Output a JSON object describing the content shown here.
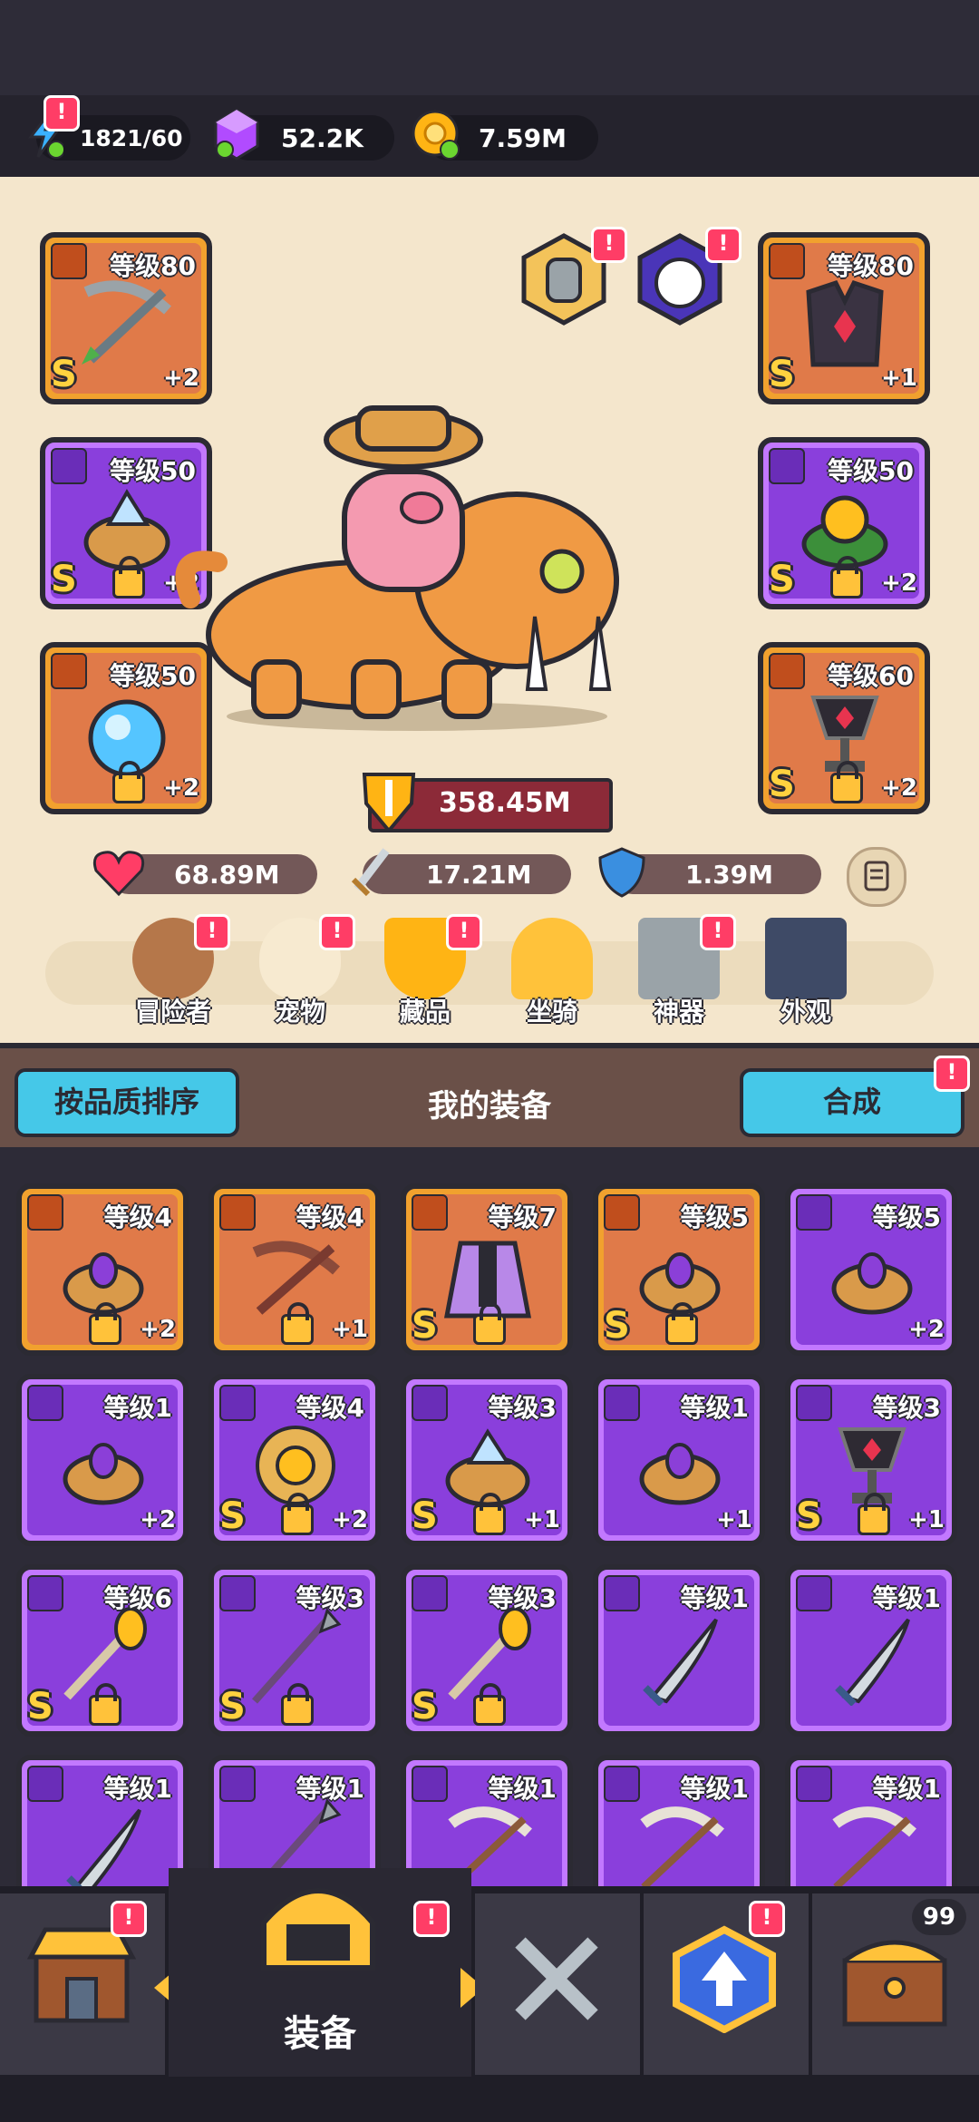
{
  "resources": {
    "energy": "1821/60",
    "gems": "52.2K",
    "gold": "7.59M"
  },
  "equipped": {
    "left": [
      {
        "level": "等级80",
        "plus": "+2",
        "grade": "S",
        "rarity": "orange",
        "item": "crossbow-icon",
        "locked": false
      },
      {
        "level": "等级50",
        "plus": "+2",
        "grade": "S",
        "rarity": "purple",
        "item": "crystal-ring-icon",
        "locked": true
      },
      {
        "level": "等级50",
        "plus": "+2",
        "grade": "",
        "rarity": "orange",
        "item": "blue-orb-necklace-icon",
        "locked": true
      }
    ],
    "right": [
      {
        "level": "等级80",
        "plus": "+1",
        "grade": "S",
        "rarity": "orange",
        "item": "dark-armor-icon",
        "locked": false
      },
      {
        "level": "等级50",
        "plus": "+2",
        "grade": "S",
        "rarity": "purple",
        "item": "gold-orb-ring-icon",
        "locked": true
      },
      {
        "level": "等级60",
        "plus": "+2",
        "grade": "S",
        "rarity": "orange",
        "item": "chalice-icon",
        "locked": true
      }
    ]
  },
  "power": "358.45M",
  "stats": {
    "hp": "68.89M",
    "attack": "17.21M",
    "defense": "1.39M"
  },
  "menu": [
    {
      "label": "冒险者",
      "icon": "capybara-icon",
      "badge": "!"
    },
    {
      "label": "宠物",
      "icon": "egg-icon",
      "badge": "!"
    },
    {
      "label": "藏品",
      "icon": "trophy-icon",
      "badge": "!"
    },
    {
      "label": "坐骑",
      "icon": "horseshoe-icon",
      "badge": ""
    },
    {
      "label": "神器",
      "icon": "hammer-icon",
      "badge": "!"
    },
    {
      "label": "外观",
      "icon": "outfit-icon",
      "badge": ""
    }
  ],
  "section": {
    "sort_label": "按品质排序",
    "title": "我的装备",
    "merge_label": "合成"
  },
  "inventory": [
    {
      "level": "等级4",
      "plus": "+2",
      "grade": "",
      "rarity": "orange",
      "item": "ring-icon"
    },
    {
      "level": "等级4",
      "plus": "+1",
      "grade": "",
      "rarity": "orange",
      "item": "crossbow-icon"
    },
    {
      "level": "等级7",
      "plus": "",
      "grade": "S",
      "rarity": "orange",
      "item": "cape-icon"
    },
    {
      "level": "等级5",
      "plus": "",
      "grade": "S",
      "rarity": "orange",
      "item": "ring-icon"
    },
    {
      "level": "等级5",
      "plus": "+2",
      "grade": "",
      "rarity": "purple",
      "item": "ring-icon"
    },
    {
      "level": "等级1",
      "plus": "+2",
      "grade": "",
      "rarity": "purple",
      "item": "ring-icon"
    },
    {
      "level": "等级4",
      "plus": "+2",
      "grade": "S",
      "rarity": "purple",
      "item": "sun-medal-icon"
    },
    {
      "level": "等级3",
      "plus": "+1",
      "grade": "S",
      "rarity": "purple",
      "item": "crystal-ring-icon"
    },
    {
      "level": "等级1",
      "plus": "+1",
      "grade": "",
      "rarity": "purple",
      "item": "ring-icon"
    },
    {
      "level": "等级3",
      "plus": "+1",
      "grade": "S",
      "rarity": "purple",
      "item": "chalice-icon"
    },
    {
      "level": "等级6",
      "plus": "",
      "grade": "S",
      "rarity": "purple",
      "item": "mace-icon"
    },
    {
      "level": "等级3",
      "plus": "",
      "grade": "S",
      "rarity": "purple",
      "item": "spear-icon"
    },
    {
      "level": "等级3",
      "plus": "",
      "grade": "S",
      "rarity": "purple",
      "item": "mace-icon"
    },
    {
      "level": "等级1",
      "plus": "",
      "grade": "",
      "rarity": "purple",
      "item": "sword-icon"
    },
    {
      "level": "等级1",
      "plus": "",
      "grade": "",
      "rarity": "purple",
      "item": "sword-icon"
    },
    {
      "level": "等级1",
      "plus": "",
      "grade": "",
      "rarity": "purple",
      "item": "sword-icon"
    },
    {
      "level": "等级1",
      "plus": "",
      "grade": "",
      "rarity": "purple",
      "item": "spear-icon"
    },
    {
      "level": "等级1",
      "plus": "",
      "grade": "",
      "rarity": "purple",
      "item": "bow-icon"
    },
    {
      "level": "等级1",
      "plus": "",
      "grade": "",
      "rarity": "purple",
      "item": "bow-icon"
    },
    {
      "level": "等级1",
      "plus": "",
      "grade": "",
      "rarity": "purple",
      "item": "bow-icon"
    }
  ],
  "nav": {
    "active_label": "装备",
    "chest_count": "99"
  },
  "colors": {
    "orange": "#f1a12e",
    "purple": "#c278ff",
    "badge": "#ff3d66",
    "blue": "#45c8e8"
  }
}
